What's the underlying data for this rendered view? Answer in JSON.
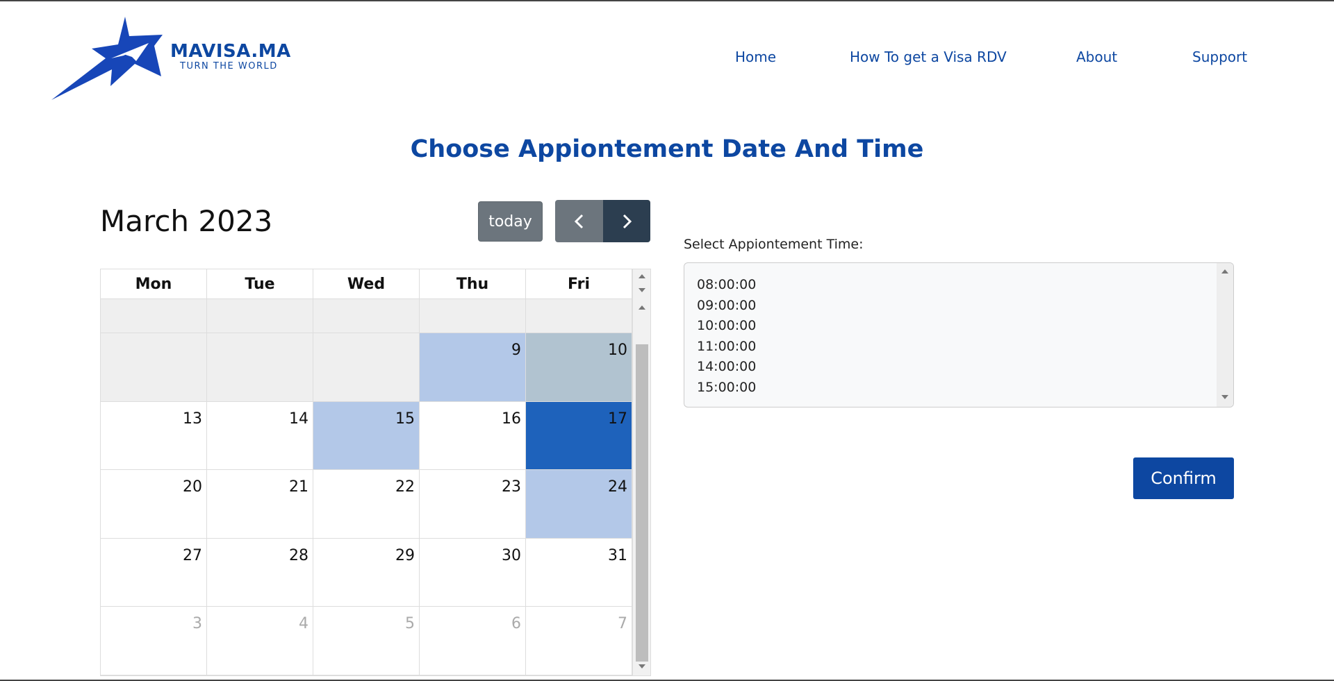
{
  "brand": {
    "name": "MAVISA.MA",
    "tagline": "TURN THE WORLD",
    "color": "#0d47a1"
  },
  "nav": [
    {
      "label": "Home"
    },
    {
      "label": "How To get a Visa RDV"
    },
    {
      "label": "About"
    },
    {
      "label": "Support"
    }
  ],
  "page_title": "Choose Appiontement Date And Time",
  "calendar": {
    "title": "March 2023",
    "today_label": "today",
    "prev_icon": "chevron-left-icon",
    "next_icon": "chevron-right-icon",
    "weekdays": [
      "Mon",
      "Tue",
      "Wed",
      "Thu",
      "Fri"
    ],
    "weeks": [
      [
        "",
        "",
        "",
        "",
        ""
      ],
      [
        "",
        "",
        "",
        "9",
        "10"
      ],
      [
        "13",
        "14",
        "15",
        "16",
        "17"
      ],
      [
        "20",
        "21",
        "22",
        "23",
        "24"
      ],
      [
        "27",
        "28",
        "29",
        "30",
        "31"
      ],
      [
        "3",
        "4",
        "5",
        "6",
        "7"
      ]
    ],
    "available_days": [
      "9",
      "15",
      "24"
    ],
    "today_day": "10",
    "selected_day": "17",
    "colors": {
      "available": "#b3c8e8",
      "today": "#b1c3d0",
      "selected": "#1e62bb",
      "other_month": "#efefef"
    }
  },
  "time_select": {
    "label": "Select Appiontement Time:",
    "options": [
      "08:00:00",
      "09:00:00",
      "10:00:00",
      "11:00:00",
      "14:00:00",
      "15:00:00"
    ]
  },
  "confirm_label": "Confirm"
}
